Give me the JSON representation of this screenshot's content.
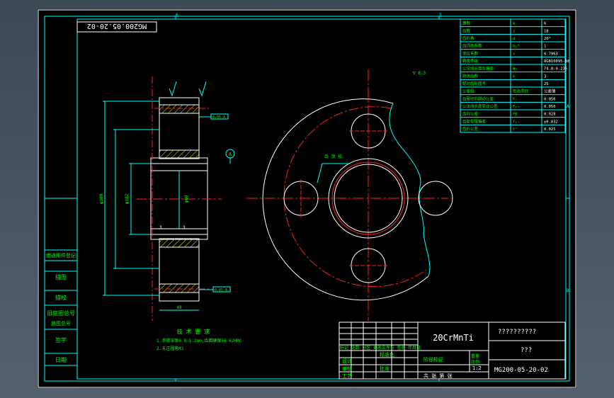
{
  "drawing": {
    "number_mirrored": "MG200.05.20-02",
    "material": "20CrMnTi",
    "title_unknown": "??????????",
    "company_unknown": "???",
    "drawing_number": "MG200-05-20-02",
    "scale": "1:2",
    "zone_marks": [
      "6",
      "5",
      "A",
      "B"
    ],
    "datum_label": "A"
  },
  "side_labels": [
    "借通用件登记",
    "描图",
    "描校",
    "旧底图总号",
    "底图总号",
    "签字",
    "日期"
  ],
  "params_table": {
    "rows": [
      [
        "模数",
        "m",
        "6"
      ],
      [
        "齿数",
        "z",
        "18"
      ],
      [
        "齿形角",
        "α",
        "20°"
      ],
      [
        "齿顶高系数",
        "hₐ*",
        "1"
      ],
      [
        "变位系数",
        "x",
        "0.7963"
      ],
      [
        "精度等级",
        "",
        "8GB10095-88"
      ],
      [
        "公法线长度及偏差",
        "Wₖ",
        "74.8-0.235"
      ],
      [
        "跨测齿数",
        "k",
        "3"
      ],
      [
        "配对齿轮图号",
        "",
        "25"
      ],
      [
        "公差组",
        "检验项目",
        "公差值"
      ],
      [
        "齿圈径向跳动公差",
        "Fᵣ",
        "0.056"
      ],
      [
        "公法线长度变动公差",
        "Fᵥᵥ",
        "0.050"
      ],
      [
        "齿向公差",
        "Fβ",
        "0.028"
      ],
      [
        "齿距极限偏差",
        "fₚₜ",
        "±0.032"
      ],
      [
        "齿形公差",
        "fᶠ",
        "0.025"
      ]
    ]
  },
  "title_block": {
    "left_rows": [
      "标记 处数 分区 更改文件号 签名 年月日",
      "设计",
      "审核",
      "工艺"
    ],
    "standardize": "标准化",
    "approve": "批准",
    "stage_mark": "阶段标记",
    "weight": "重量",
    "scale_label": "比例",
    "sheets": "共 张 第 张"
  },
  "tech_notes": {
    "title": "技 术 要 求",
    "line1": "1.渗碳深度0.8-1.2mm,齿面硬度56-62HRC",
    "line2": "2.未注圆角R1"
  },
  "annotations": {
    "surface_finish": "∇ 6.3",
    "leader_note": "齿 顶 校",
    "dia_outer": "φ300",
    "dia_mid": "φ182",
    "dia_bore": "φ68",
    "fcf_top": "0.05 A",
    "fcf_bottom": "0.05 A",
    "width_dim": "48",
    "small_dim1": "3",
    "small_dim2": "3"
  },
  "colors": {
    "background": "#000000",
    "border": "#ffffff",
    "frame": "#00ffff",
    "center_line": "#ff2020",
    "text": "#00ff00",
    "outline": "#ffffff",
    "hatch": "#ffff00"
  }
}
